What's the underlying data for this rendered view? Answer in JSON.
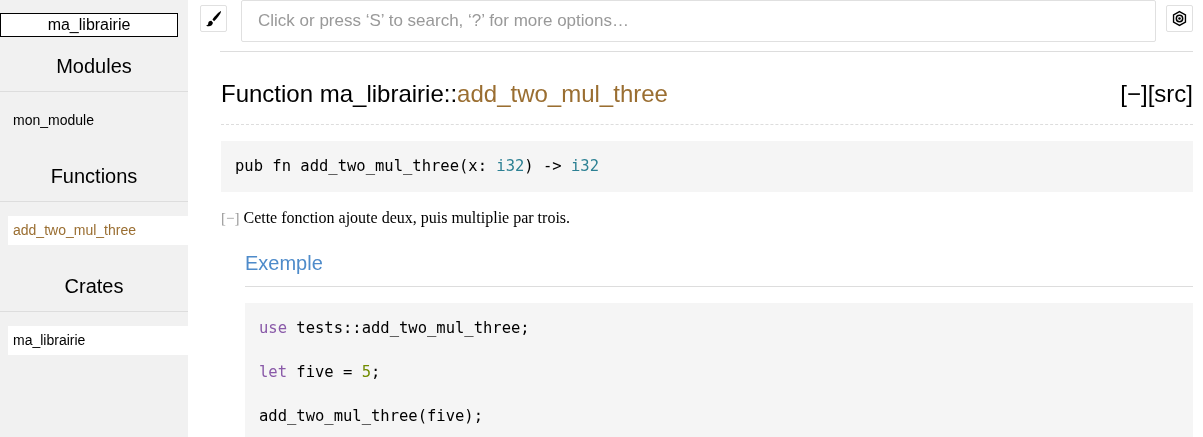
{
  "sidebar": {
    "crate_name": "ma_librairie",
    "sections": [
      {
        "heading": "Modules",
        "items": [
          {
            "label": "mon_module",
            "kind": "module",
            "selected": false
          }
        ]
      },
      {
        "heading": "Functions",
        "items": [
          {
            "label": "add_two_mul_three",
            "kind": "function",
            "selected": true
          }
        ]
      },
      {
        "heading": "Crates",
        "items": [
          {
            "label": "ma_librairie",
            "kind": "crate",
            "selected": true
          }
        ]
      }
    ]
  },
  "search": {
    "placeholder": "Click or press ‘S’ to search, ‘?’ for more options…"
  },
  "heading": {
    "prefix": "Function ",
    "crate": "ma_librairie",
    "separator": "::",
    "name": "add_two_mul_three",
    "controls": "[−][src]"
  },
  "signature": [
    {
      "text": "pub fn add_two_mul_three(x: ",
      "kind": "plain"
    },
    {
      "text": "i32",
      "kind": "type"
    },
    {
      "text": ") -> ",
      "kind": "plain"
    },
    {
      "text": "i32",
      "kind": "type"
    }
  ],
  "docs": {
    "toggle": "[−]",
    "summary": "Cette fonction ajoute deux, puis multiplie par trois.",
    "section_title": "Exemple",
    "example": [
      [
        {
          "text": "use",
          "kind": "keyword"
        },
        {
          "text": " tests::add_two_mul_three;",
          "kind": "plain"
        }
      ],
      [
        {
          "text": "let",
          "kind": "keyword"
        },
        {
          "text": " five = ",
          "kind": "plain"
        },
        {
          "text": "5",
          "kind": "number"
        },
        {
          "text": ";",
          "kind": "plain"
        }
      ],
      [
        {
          "text": "add_two_mul_three(five);",
          "kind": "plain"
        }
      ]
    ]
  }
}
